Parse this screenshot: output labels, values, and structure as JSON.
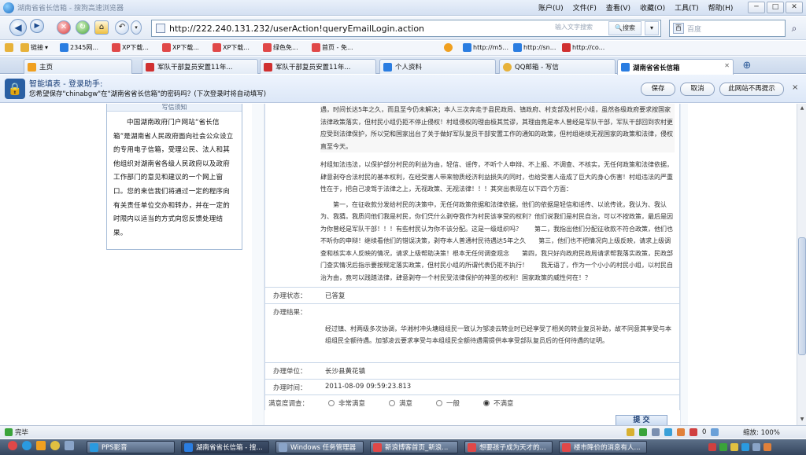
{
  "window": {
    "title": "湖南省省长信箱 - 搜狗高速浏览器",
    "menus": [
      "账户(U)",
      "文件(F)",
      "查看(V)",
      "收藏(O)",
      "工具(T)",
      "帮助(H)"
    ]
  },
  "nav": {
    "url": "http://222.240.131.232/userAction!queryEmailLogin.action",
    "search_hint": "输入文字搜索",
    "search_label": "搜索",
    "engine_placeholder": "百度"
  },
  "bookmarks": [
    {
      "label": "链接",
      "color": "#e7b23a"
    },
    {
      "label": "2345网...",
      "color": "#2a7de1"
    },
    {
      "label": "XP下载...",
      "color": "#e04848"
    },
    {
      "label": "XP下载...",
      "color": "#e04848"
    },
    {
      "label": "XP下载...",
      "color": "#e04848"
    },
    {
      "label": "绿色免...",
      "color": "#e04848"
    },
    {
      "label": "首页 - 免...",
      "color": "#e04848"
    },
    {
      "label": "",
      "color": "#f0a020"
    },
    {
      "label": "http://m5...",
      "color": "#2a7de1"
    },
    {
      "label": "http://sn...",
      "color": "#2a7de1"
    },
    {
      "label": "http://co...",
      "color": "#d03030"
    }
  ],
  "tabs": [
    {
      "label": "主页",
      "active": false,
      "color": "#f0a020"
    },
    {
      "label": "军队干部复员安置11年...",
      "active": false,
      "color": "#d03030"
    },
    {
      "label": "军队干部复员安置11年...",
      "active": false,
      "color": "#d03030"
    },
    {
      "label": "个人资料",
      "active": false,
      "color": "#2a7de1"
    },
    {
      "label": "QQ邮箱 - 写信",
      "active": false,
      "color": "#e7b23a"
    },
    {
      "label": "湖南省省长信箱",
      "active": true,
      "color": "#2a7de1"
    }
  ],
  "helper": {
    "title": "智能填表 - 登录助手:",
    "message": "您希望保存\"chinabgw\"在\"湖南省省长信箱\"的密码吗？(下次登录时将自动填写)",
    "save": "保存",
    "cancel": "取消",
    "never": "此网站不再提示",
    "close": "×"
  },
  "left_card": {
    "caption": "写信须知",
    "text": "中国湖南政府门户网站“省长信箱”是湖南省人民政府面向社会公众设立的专用电子信箱，受理公民、法人和其他组织对湖南省各级人民政府以及政府工作部门的意见和建议的一个网上窗口。您的来信我们将通过一定的程序向有关责任单位交办和转办，并在一定的时限内以适当的方式向您反馈处理结果。"
  },
  "letter": {
    "p1": "遇，时间长达5年之久，而且至今仍未解决；本人三次奔走于县民政局、镇政府、村支部及村民小组，虽然各级政府要求按国家法律政策落实，但村民小组仍拒不停止侵权！村组侵权的理由极其荒谬，其理由竟是本人曾经是军队干部，军队干部回到农村更应受到法律保护，所以党和国家出台了关于做好军队复员干部安置工作的通知的政策，但村组继续无视国家的政策和法律，侵权直至今天。",
    "p2": "村组知法违法，以保护部分村民的利益为由，轻信、谣传，不听个人申辩、不上报、不调查、不核实，无任何政策和法律依据，肆意剥夺合法村民的基本权利，在经受害人带来物质经济利益损失的同时，也给受害人造成了巨大的身心伤害！村组违法的严重性在于，把自己凌驾于法律之上，无视政策、无视法律！！！其突出表现在以下四个方面：",
    "p3": "第一，在征收款分发给村民的决策中，无任何政策依据和法律依据，他们的依据是轻信和谣传、以讹传讹，我认为、我认为、我猜。我质问他们我是村民，你们凭什么剥夺我作为村民该享受的权利？他们说我们是村民自治，可以不按政策，最后是因为你曾经是军队干部！！！有些村民认为你不该分配。这是一级组织吗？　　第二，我指出他们分配征收款不符合政策，他们也不听你的申辩！继续看他们的错误决策，剥夺本人普通村民待遇达5年之久　　第三，他们也不把情况向上级反映，请求上级调查和核实本人反映的情况，请求上级帮助决策！根本无任何调查观念　　第四，我只好向政府民政局请求帮我落实政策，民政部门查实情况后指示要按规定落实政策，但村民小组的所谓代表仍拒不执行！　　我无语了，作为一个小小的村民小组，以村民自治为由，竟可以践踏法律，肆意剥夺一个村民受法律保护的神圣的权利！国家政策的威性何在！？"
  },
  "fields": {
    "status_label": "办理状态：",
    "status_value": "已答复",
    "result_label": "办理结果：",
    "result_value": "经过镇、村两级多次协调，华湘村冲头塘组组民一致认为邹凌云转业时已经享受了相关的转业复员补助，故不同意其享受与本组组民全额待遇。加邹凌云要求享受与本组组民全额待遇需提供本享受部队复员后的任何待遇的证明。",
    "unit_label": "办理单位：",
    "unit_value": "长沙县黄花镇",
    "time_label": "办理时间：",
    "time_value": "2011-08-09 09:59:23.813",
    "survey_label": "满意度调查：",
    "survey_options": [
      "非常满意",
      "满意",
      "一般",
      "不满意"
    ],
    "survey_selected": 3,
    "submit": "提 交"
  },
  "status": {
    "text": "完毕",
    "zoom": "缩放: 100%",
    "counter": "0"
  },
  "taskbar": {
    "items": [
      {
        "label": "PPS影音",
        "color": "#2a9ae0"
      },
      {
        "label": "湖南省省长信箱 - 搜...",
        "color": "#2a7de1"
      },
      {
        "label": "Windows 任务管理器",
        "color": "#8aa4c8"
      },
      {
        "label": "新浪博客首页_新浪...",
        "color": "#e04848"
      },
      {
        "label": "想要孩子成为天才的...",
        "color": "#e04848"
      },
      {
        "label": "楼市降价的消息有人...",
        "color": "#e04848"
      }
    ]
  }
}
